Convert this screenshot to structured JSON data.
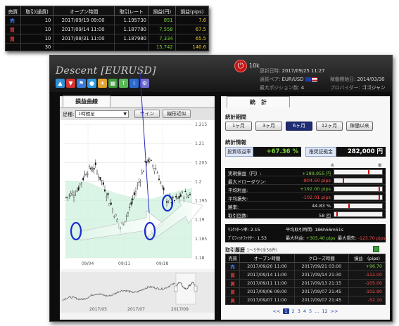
{
  "overlay": {
    "headers": [
      "売買",
      "取引(通貨)",
      "オープン時間",
      "取引レート",
      "損益(円)",
      "損益(pips)"
    ],
    "rows": [
      {
        "type": "売",
        "type_color": "#3f7be8",
        "qty": "10",
        "open": "2017/09/19 09:00",
        "rate": "1.195730",
        "pl_yen": "851",
        "pl_pips": "7.6"
      },
      {
        "type": "買",
        "type_color": "#e23b3b",
        "qty": "10",
        "open": "2017/09/14 11:00",
        "rate": "1.187780",
        "pl_yen": "7,558",
        "pl_pips": "67.5"
      },
      {
        "type": "買",
        "type_color": "#e23b3b",
        "qty": "10",
        "open": "2017/08/31 11:00",
        "rate": "1.187980",
        "pl_yen": "7,334",
        "pl_pips": "65.5"
      }
    ],
    "total": {
      "qty": "30",
      "pl_yen": "15,742",
      "pl_pips": "140.6"
    }
  },
  "header": {
    "title": "Descent [EURUSD]",
    "lot": "10k",
    "updated_label": "更新日時:",
    "updated_value": "2017/09/25 11:27",
    "pair_label": "通貨ペア:",
    "pair_value": "EUR/USD",
    "start_label": "稼働開始日:",
    "start_value": "2014/03/30",
    "maxpos_label": "最大ポジション数:",
    "maxpos_value": "4",
    "provider_label": "プロバイダー:",
    "provider_value": "ゴゴジャン",
    "icons": [
      "trend-up-icon",
      "trend-down-icon",
      "flag-icon",
      "globe-icon",
      "sun-icon",
      "chart-icon",
      "arrow-up-icon",
      "info-icon",
      "gear-icon"
    ]
  },
  "chart_panel": {
    "tab": "損益曲線",
    "timeframe_label": "足種:",
    "timeframe_value": "1時間足",
    "sign_button": "サイン",
    "trendline_button": "線形近似",
    "y_ticks": [
      "1.215",
      "1.21",
      "1.205",
      "1.2",
      "1.195",
      "1.19",
      "1.185",
      "1.18"
    ],
    "x_ticks": [
      "09/04",
      "09/11",
      "09/18"
    ],
    "mini_x_ticks": [
      "2017/05",
      "2017/07",
      "2017/09"
    ]
  },
  "stats": {
    "tab": "統　計",
    "period_title": "統計期間",
    "periods": [
      "1ヶ月",
      "3ヶ月",
      "6ヶ月",
      "12ヶ月",
      "稼働以来"
    ],
    "active_period": 2,
    "info_title": "統計情報",
    "roi_label": "投資収益率",
    "roi_value": "+67.36 %",
    "margin_label": "推奨証拠金",
    "margin_value": "282,000 円",
    "bar_scale": [
      "劣",
      "優"
    ],
    "rows": [
      {
        "label": "実現損益（円）:",
        "value": "+189,955 円",
        "color": "#7cd43a",
        "marker": 0.72
      },
      {
        "label": "最大ドローダウン:",
        "value": "-804.50 pips",
        "color": "#ff4d4d",
        "marker": 0.18
      },
      {
        "label": "平均利益:",
        "value": "+192.00 pips",
        "color": "#7cd43a",
        "marker": 0.96
      },
      {
        "label": "平均損失:",
        "value": "-102.01 pips",
        "color": "#ff4d4d",
        "marker": 0.96
      },
      {
        "label": "勝率:",
        "value": "44.83 %",
        "color": "#eaeaea",
        "marker": 0.3
      },
      {
        "label": "取引回数:",
        "value": "58 回",
        "color": "#eaeaea",
        "marker": 0.04
      }
    ],
    "extra": {
      "rf_label": "ﾘｽｸﾘﾀｰﾝ率:",
      "rf_value": "2.15",
      "avg_hold_label": "平均取引時間:",
      "avg_hold_value": "186h56m51s",
      "pf_label": "ﾌﾟﾛﾌｨｯﾄﾌｧｸﾀｰ:",
      "pf_value": "1.53",
      "max_win_label": "最大利益:",
      "max_win_value": "+305.40 pips",
      "max_loss_label": "最大損失:",
      "max_loss_value": "-123.70 pips"
    },
    "history_title": "取引履歴",
    "history_sub": "1〜5件(全58件)",
    "history_headers": [
      "売買",
      "オープン時間",
      "クローズ時間",
      "損益　(pips)"
    ],
    "history_rows": [
      {
        "type": "売",
        "type_color": "#3f7be8",
        "open": "2017/09/20 11:00",
        "close": "2017/09/21 03:00",
        "pl": "+96.70",
        "pl_color": "#7cd43a"
      },
      {
        "type": "買",
        "type_color": "#e23b3b",
        "open": "2017/09/14 11:00",
        "close": "2017/09/14 21:30",
        "pl": "-112.00",
        "pl_color": "#ff4d4d"
      },
      {
        "type": "買",
        "type_color": "#e23b3b",
        "open": "2017/09/11 11:00",
        "close": "2017/09/13 21:15",
        "pl": "-105.00",
        "pl_color": "#ff4d4d"
      },
      {
        "type": "買",
        "type_color": "#e23b3b",
        "open": "2017/09/06 09:00",
        "close": "2017/09/07 21:45",
        "pl": "-102.90",
        "pl_color": "#ff4d4d"
      },
      {
        "type": "買",
        "type_color": "#e23b3b",
        "open": "2017/09/07 11:00",
        "close": "2017/09/07 21:45",
        "pl": "-52.10",
        "pl_color": "#ff4d4d"
      }
    ],
    "pagination": [
      "<<",
      "1",
      "2",
      "3",
      "4",
      "5",
      "...",
      "12",
      ">>"
    ],
    "current_page": "1"
  }
}
